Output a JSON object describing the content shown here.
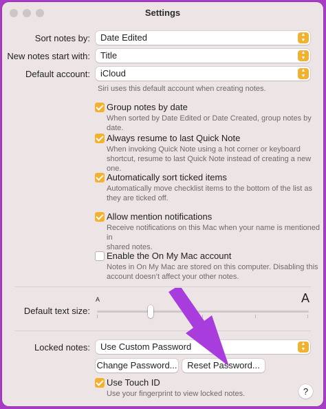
{
  "window": {
    "title": "Settings"
  },
  "sort_notes": {
    "label": "Sort notes by:",
    "value": "Date Edited"
  },
  "new_notes": {
    "label": "New notes start with:",
    "value": "Title"
  },
  "default_account": {
    "label": "Default account:",
    "value": "iCloud",
    "description": "Siri uses this default account when creating notes."
  },
  "options": {
    "group_by_date": {
      "label": "Group notes by date",
      "checked": true,
      "description": [
        "When sorted by Date Edited or Date Created, group notes by date."
      ]
    },
    "resume_quick_note": {
      "label": "Always resume to last Quick Note",
      "checked": true,
      "description": [
        "When invoking Quick Note using a hot corner or keyboard",
        "shortcut, resume to last Quick Note instead of creating a new one."
      ]
    },
    "sort_ticked": {
      "label": "Automatically sort ticked items",
      "checked": true,
      "description": [
        "Automatically move checklist items to the bottom of the list as",
        "they are ticked off."
      ]
    },
    "mention_notifications": {
      "label": "Allow mention notifications",
      "checked": true,
      "description": [
        "Receive notifications on this Mac when your name is mentioned in",
        "shared notes."
      ]
    },
    "on_my_mac": {
      "label": "Enable the On My Mac account",
      "checked": false,
      "description": [
        "Notes in On My Mac are stored on this computer. Disabling this",
        "account doesn’t affect your other notes."
      ]
    }
  },
  "text_size": {
    "label": "Default text size:",
    "small_glyph": "A",
    "large_glyph": "A",
    "level": 0.2
  },
  "locked_notes": {
    "label": "Locked notes:",
    "value": "Use Custom Password",
    "change_password": "Change Password...",
    "reset_password": "Reset Password...",
    "touch_id": {
      "label": "Use Touch ID",
      "checked": true,
      "description": "Use your fingerprint to view locked notes."
    }
  },
  "help": "?",
  "colors": {
    "accent": "#f2b12f",
    "arrow": "#a93cdc",
    "background": "#a93cc4"
  }
}
